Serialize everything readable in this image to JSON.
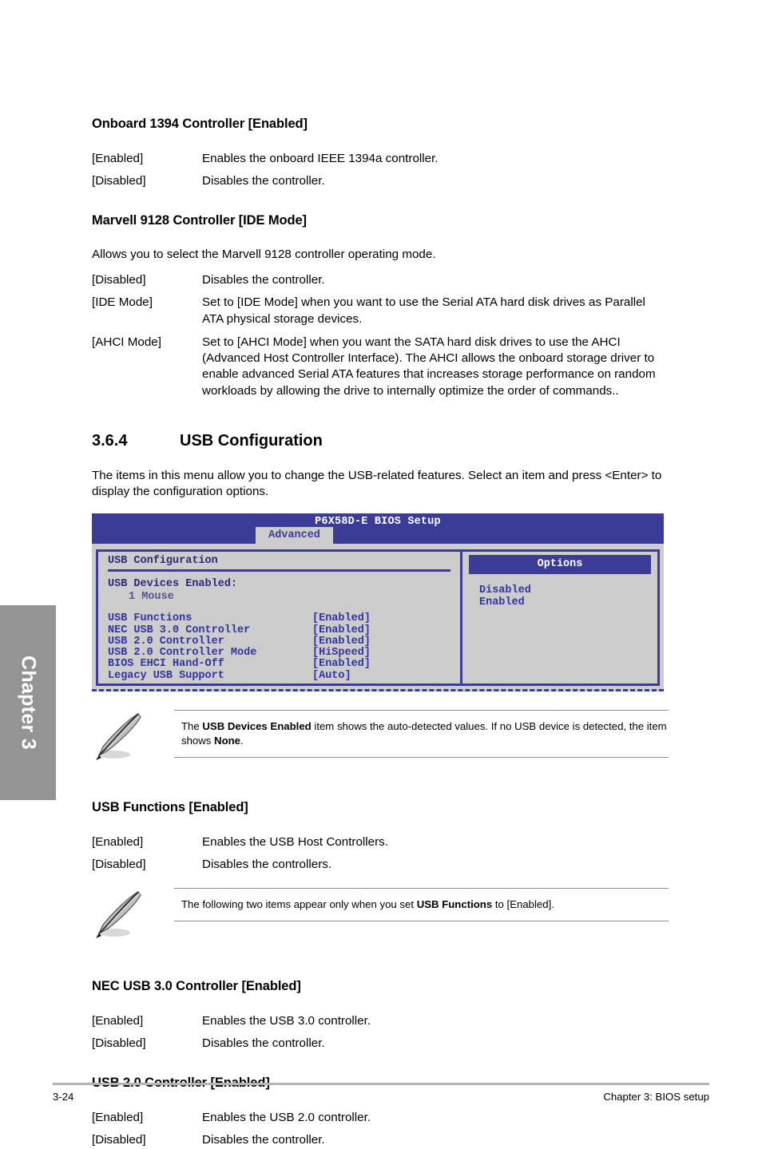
{
  "chapter_tab": {
    "label": "Chapter 3"
  },
  "sections": [
    {
      "heading": "Onboard 1394 Controller [Enabled]",
      "rows": [
        {
          "term": "[Enabled]",
          "desc": "Enables the onboard IEEE 1394a controller."
        },
        {
          "term": "[Disabled]",
          "desc": "Disables the controller."
        }
      ]
    },
    {
      "heading": "Marvell 9128 Controller [IDE Mode]",
      "intro": "Allows you to select the Marvell 9128 controller operating mode.",
      "rows": [
        {
          "term": "[Disabled]",
          "desc": "Disables the controller."
        },
        {
          "term": "[IDE Mode]",
          "desc": "Set to [IDE Mode] when you want to use the Serial ATA hard disk drives as Parallel ATA physical storage devices."
        },
        {
          "term": "[AHCI Mode]",
          "desc": "Set to [AHCI Mode] when you want the SATA hard disk drives to use the AHCI (Advanced Host Controller Interface). The AHCI allows the onboard storage driver to enable advanced Serial ATA features that increases storage performance on random workloads by allowing the drive to internally optimize the order of commands.."
        }
      ]
    }
  ],
  "numbered_section": {
    "number": "3.6.4",
    "title": "USB Configuration",
    "intro": "The items in this menu allow you to change the USB-related features. Select an item and press <Enter> to display the configuration options."
  },
  "bios": {
    "title": "P6X58D-E BIOS Setup",
    "active_tab": "Advanced",
    "panel_heading": "USB Configuration",
    "devices_label": "USB Devices Enabled:",
    "devices": [
      "1 Mouse"
    ],
    "items": [
      {
        "name": "USB Functions",
        "value": "[Enabled]"
      },
      {
        "name": "NEC USB 3.0 Controller",
        "value": "[Enabled]"
      },
      {
        "name": "USB 2.0 Controller",
        "value": "[Enabled]"
      },
      {
        "name": "USB 2.0 Controller Mode",
        "value": "[HiSpeed]"
      },
      {
        "name": "BIOS EHCI Hand-Off",
        "value": "[Enabled]"
      },
      {
        "name": "Legacy USB Support",
        "value": "[Auto]"
      }
    ],
    "options_header": "Options",
    "options": [
      "Disabled",
      "Enabled"
    ],
    "colors": {
      "header_blue": "#3c3c96",
      "body_gray": "#cccccc",
      "text_blue": "#3333a0"
    }
  },
  "note_1": {
    "icon": "pencil-note-icon",
    "text_parts": [
      {
        "text": "The ",
        "bold": false
      },
      {
        "text": "USB Devices Enabled",
        "bold": true
      },
      {
        "text": " item shows the auto-detected values. If no USB device is detected, the item shows ",
        "bold": false
      },
      {
        "text": "None",
        "bold": true
      },
      {
        "text": ".",
        "bold": false
      }
    ]
  },
  "note_2": {
    "icon": "pencil-note-icon",
    "text_parts": [
      {
        "text": "The following two items appear only when you set ",
        "bold": false
      },
      {
        "text": "USB Functions",
        "bold": true
      },
      {
        "text": " to [Enabled].",
        "bold": false
      }
    ]
  },
  "sections_after": [
    {
      "heading": "USB Functions [Enabled]",
      "rows": [
        {
          "term": "[Enabled]",
          "desc": "Enables the USB Host Controllers."
        },
        {
          "term": "[Disabled]",
          "desc": "Disables the controllers."
        }
      ]
    },
    {
      "heading": "NEC USB 3.0 Controller [Enabled]",
      "rows": [
        {
          "term": "[Enabled]",
          "desc": "Enables the USB 3.0 controller."
        },
        {
          "term": "[Disabled]",
          "desc": "Disables the controller."
        }
      ]
    },
    {
      "heading": "USB 2.0 Controller [Enabled]",
      "rows": [
        {
          "term": "[Enabled]",
          "desc": "Enables the USB 2.0 controller."
        },
        {
          "term": "[Disabled]",
          "desc": "Disables the controller."
        }
      ]
    }
  ],
  "footer": {
    "page_number": "3-24",
    "chapter_label": "Chapter 3: BIOS setup"
  }
}
